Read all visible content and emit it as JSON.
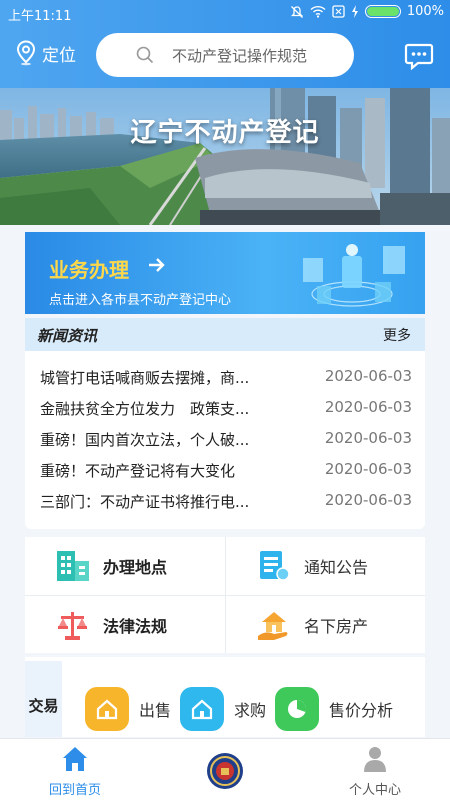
{
  "status": {
    "time": "上午11:11",
    "battery": "100%",
    "battery_level": 1.0
  },
  "header": {
    "location_label": "定位",
    "search_placeholder": "不动产登记操作规范"
  },
  "banner": {
    "title": "辽宁不动产登记"
  },
  "business": {
    "title": "业务办理",
    "subtitle": "点击进入各市县不动产登记中心"
  },
  "news": {
    "title": "新闻资讯",
    "more": "更多",
    "items": [
      {
        "text": "城管打电话喊商贩去摆摊，商...",
        "date": "2020-06-03"
      },
      {
        "text": "金融扶贫全方位发力　政策支...",
        "date": "2020-06-03"
      },
      {
        "text": "重磅！国内首次立法，个人破...",
        "date": "2020-06-03"
      },
      {
        "text": "重磅！不动产登记将有大变化",
        "date": "2020-06-03"
      },
      {
        "text": "三部门：不动产证书将推行电...",
        "date": "2020-06-03"
      }
    ]
  },
  "services": [
    {
      "label": "办理地点",
      "icon": "building-icon"
    },
    {
      "label": "通知公告",
      "icon": "notice-icon"
    },
    {
      "label": "法律法规",
      "icon": "scales-icon"
    },
    {
      "label": "名下房产",
      "icon": "house-hand-icon"
    }
  ],
  "trade": {
    "tab": "交易",
    "items": [
      {
        "label": "出售",
        "icon": "house-icon",
        "color": "#f7b52c"
      },
      {
        "label": "求购",
        "icon": "house-icon",
        "color": "#2fb8ee"
      },
      {
        "label": "售价分析",
        "icon": "pie-chart-icon",
        "color": "#3ec95a"
      }
    ]
  },
  "nav": {
    "home": "回到首页",
    "profile": "个人中心"
  },
  "colors": {
    "primary": "#2d8de8",
    "accent_yellow": "#ffd84a"
  }
}
